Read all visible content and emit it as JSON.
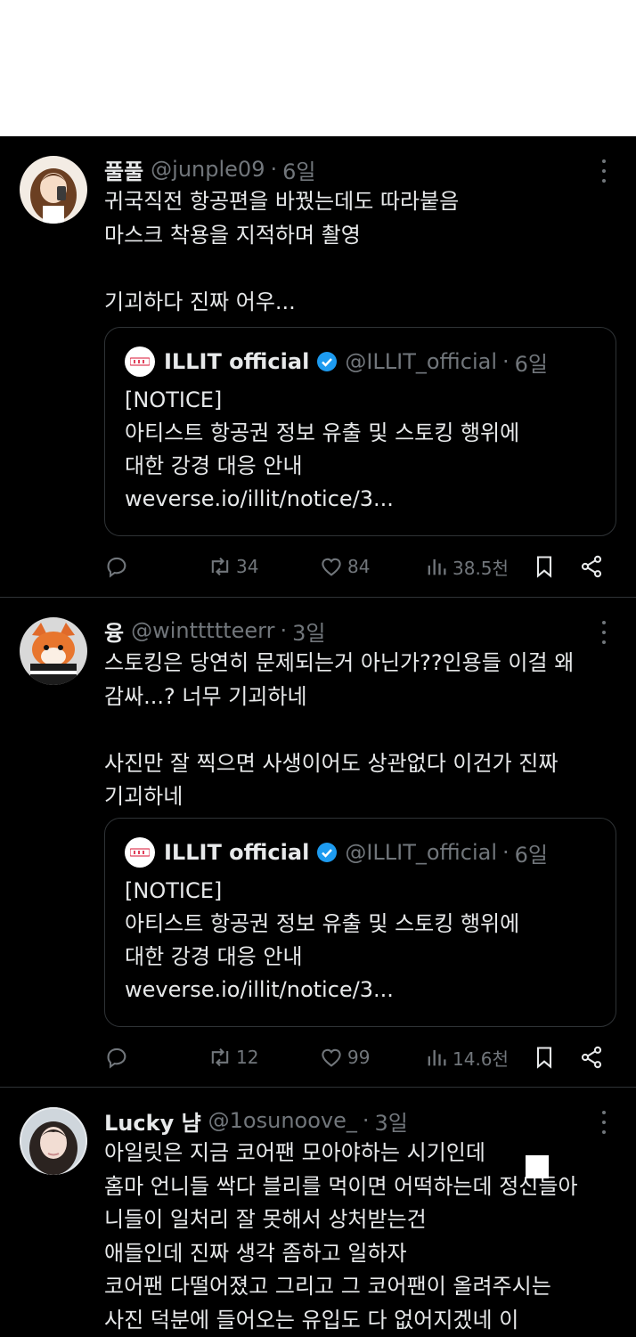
{
  "tweets": [
    {
      "name": "풀풀",
      "handle": "@junple09",
      "time": "6일",
      "lines": [
        "귀국직전 항공편을 바꿨는데도 따라붙음",
        "마스크 착용을 지적하며 촬영",
        "",
        "기괴하다 진짜 어우..."
      ],
      "quote": {
        "logo": "ILLIT",
        "name": "ILLIT official",
        "handle": "@ILLIT_official",
        "time": "6일",
        "lines": [
          "[NOTICE]",
          "아티스트 항공권 정보 유출 및 스토킹 행위에",
          "대한 강경 대응 안내",
          "weverse.io/illit/notice/3..."
        ]
      },
      "stats": {
        "replies": "",
        "retweets": "34",
        "likes": "84",
        "views": "38.5천"
      }
    },
    {
      "name": "융",
      "handle": "@winttttteerr",
      "time": "3일",
      "lines": [
        "스토킹은 당연히 문제되는거 아닌가??인용들 이걸 왜",
        "감싸...? 너무 기괴하네",
        "",
        "사진만 잘 찍으면 사생이어도 상관없다 이건가 진짜",
        "기괴하네"
      ],
      "quote": {
        "logo": "ILLIT",
        "name": "ILLIT official",
        "handle": "@ILLIT_official",
        "time": "6일",
        "lines": [
          "[NOTICE]",
          "아티스트 항공권 정보 유출 및 스토킹 행위에",
          "대한 강경 대응 안내",
          "weverse.io/illit/notice/3..."
        ]
      },
      "stats": {
        "replies": "",
        "retweets": "12",
        "likes": "99",
        "views": "14.6천"
      }
    },
    {
      "name": "Lucky 냠",
      "handle": "@1osunoove_",
      "time": "3일",
      "lines": [
        "아일릿은 지금 코어팬 모아야하는 시기인데",
        "홈마 언니들 싹다 블리를 먹이면 어떡하는데 정신들아",
        "니들이 일처리 잘 못해서 상처받는건",
        "애들인데 진짜 생각 좀하고 일하자",
        "코어팬 다떨어졌고 그리고 그 코어팬이 올려주시는",
        "사진 덕분에 들어오는 유입도 다 없어지겠네 이"
      ]
    }
  ],
  "colors": {
    "background": "#000000",
    "text": "#e7e9ea",
    "muted": "#71767b",
    "border": "#2f3336",
    "verified": "#1d9bf0"
  },
  "icons": [
    "more-icon",
    "verified-badge-icon",
    "reply-icon",
    "retweet-icon",
    "like-icon",
    "views-icon",
    "bookmark-icon",
    "share-icon"
  ]
}
